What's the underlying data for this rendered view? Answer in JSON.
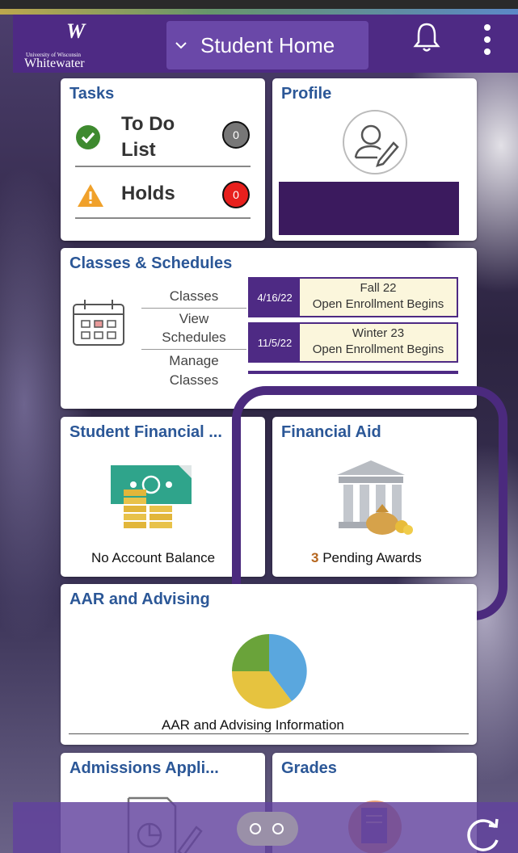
{
  "header": {
    "logo_university": "University of Wisconsin",
    "logo_name": "Whitewater",
    "page_selector": "Student Home"
  },
  "tasks": {
    "title": "Tasks",
    "items": [
      {
        "label_line1": "To Do",
        "label_line2": "List",
        "count": "0",
        "icon": "check-circle-icon"
      },
      {
        "label": "Holds",
        "count": "0",
        "icon": "warning-icon"
      }
    ]
  },
  "profile": {
    "title": "Profile"
  },
  "classes": {
    "title": "Classes & Schedules",
    "links": [
      "Classes",
      "View",
      "Schedules",
      "Manage",
      "Classes"
    ],
    "events": [
      {
        "date": "4/16/22",
        "term": "Fall 22",
        "desc": "Open Enrollment Begins"
      },
      {
        "date": "11/5/22",
        "term": "Winter 23",
        "desc": "Open Enrollment Begins"
      }
    ]
  },
  "student_financial": {
    "title": "Student Financial ...",
    "caption": "No Account Balance"
  },
  "financial_aid": {
    "title": "Financial Aid",
    "pending_count": "3",
    "pending_label": "Pending Awards"
  },
  "aar": {
    "title": "AAR and Advising",
    "caption": "AAR and Advising Information"
  },
  "admissions": {
    "title": "Admissions Appli..."
  },
  "grades": {
    "title": "Grades"
  },
  "colors": {
    "brand_purple": "#4e2a84",
    "title_blue": "#2b5797",
    "pie_blue": "#5aa7de",
    "pie_yellow": "#e6c33f",
    "pie_green": "#6aa33a"
  }
}
